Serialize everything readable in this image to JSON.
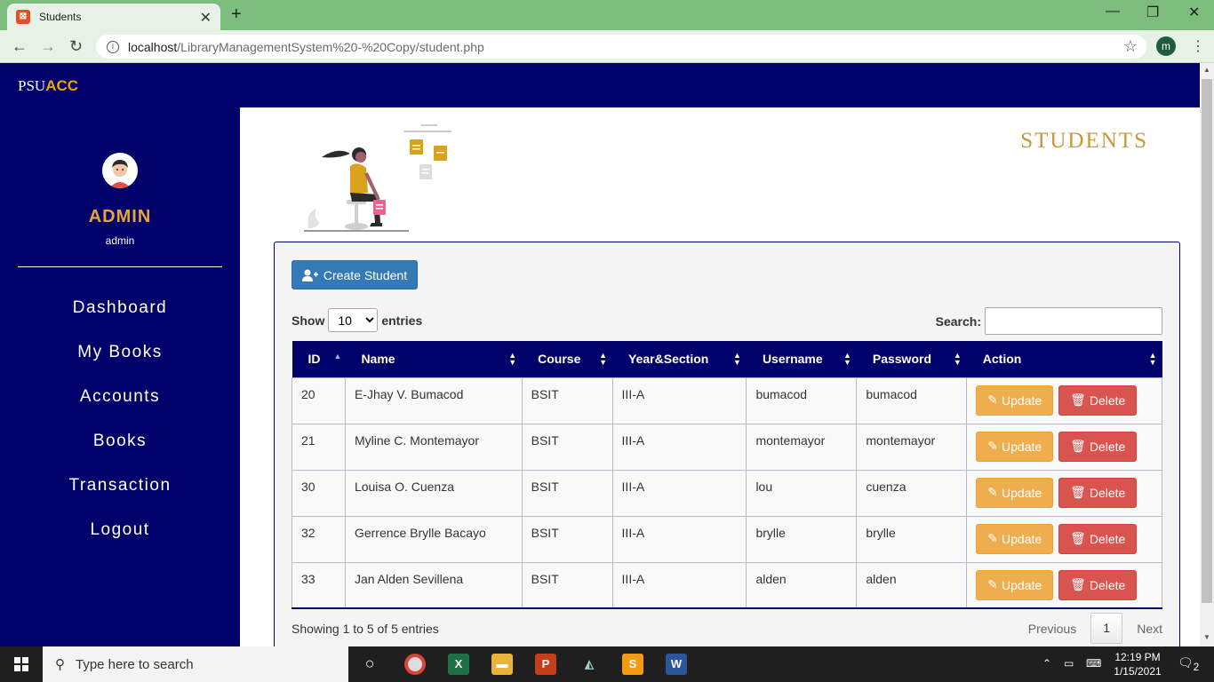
{
  "browser": {
    "tab_title": "Students",
    "url_host": "localhost",
    "url_path": "/LibraryManagementSystem%20-%20Copy/student.php",
    "profile_initial": "m"
  },
  "brand": {
    "prefix": "PSU",
    "suffix": "ACC"
  },
  "sidebar": {
    "role": "ADMIN",
    "username": "admin",
    "items": [
      {
        "label": "Dashboard"
      },
      {
        "label": "My Books"
      },
      {
        "label": "Accounts"
      },
      {
        "label": "Books"
      },
      {
        "label": "Transaction"
      },
      {
        "label": "Logout"
      }
    ]
  },
  "page": {
    "heading": "STUDENTS",
    "create_label": "Create Student",
    "show_label": "Show",
    "entries_label": "entries",
    "entries_value": "10",
    "search_label": "Search:",
    "search_value": "",
    "columns": [
      "ID",
      "Name",
      "Course",
      "Year&Section",
      "Username",
      "Password",
      "Action"
    ],
    "update_label": "Update",
    "delete_label": "Delete",
    "rows": [
      {
        "id": "20",
        "name": "E-Jhay V. Bumacod",
        "course": "BSIT",
        "year_section": "III-A",
        "username": "bumacod",
        "password": "bumacod"
      },
      {
        "id": "21",
        "name": "Myline C. Montemayor",
        "course": "BSIT",
        "year_section": "III-A",
        "username": "montemayor",
        "password": "montemayor"
      },
      {
        "id": "30",
        "name": "Louisa O. Cuenza",
        "course": "BSIT",
        "year_section": "III-A",
        "username": "lou",
        "password": "cuenza"
      },
      {
        "id": "32",
        "name": "Gerrence Brylle Bacayo",
        "course": "BSIT",
        "year_section": "III-A",
        "username": "brylle",
        "password": "brylle"
      },
      {
        "id": "33",
        "name": "Jan Alden Sevillena",
        "course": "BSIT",
        "year_section": "III-A",
        "username": "alden",
        "password": "alden"
      }
    ],
    "info": "Showing 1 to 5 of 5 entries",
    "pager": {
      "previous": "Previous",
      "current": "1",
      "next": "Next"
    }
  },
  "taskbar": {
    "search_placeholder": "Type here to search",
    "time": "12:19 PM",
    "date": "1/15/2021",
    "notifications": "2"
  },
  "colors": {
    "navy": "#00006b",
    "accent": "#e8a33a",
    "primary_button": "#337ab7",
    "update_button": "#f0ad4e",
    "delete_button": "#d9534f"
  }
}
